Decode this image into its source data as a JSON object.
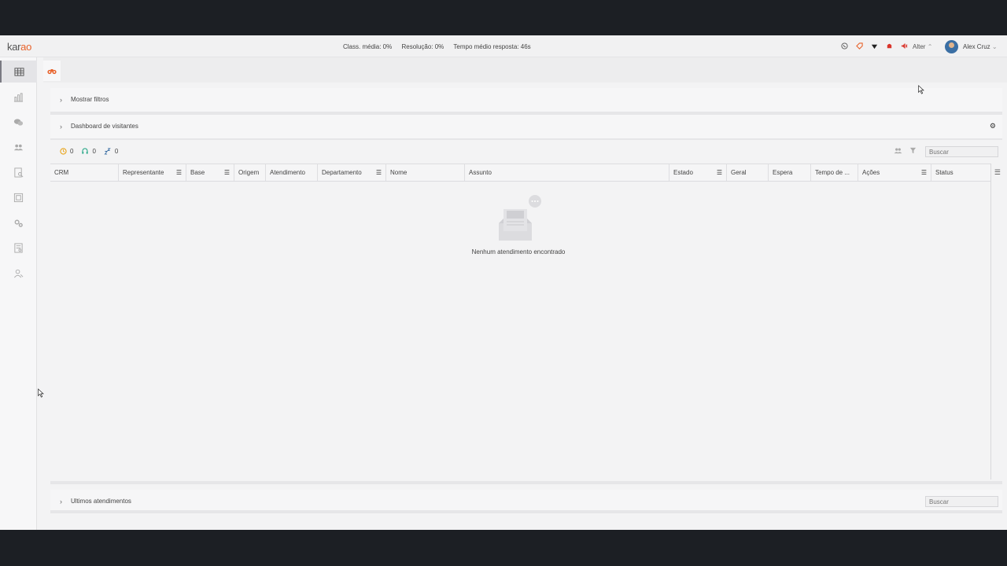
{
  "app": {
    "logo_text_a": "kar",
    "logo_text_b": "ao"
  },
  "header": {
    "stats": {
      "class_media": "Class. média: 0%",
      "resolucao": "Resolução: 0%",
      "tempo_medio": "Tempo médio resposta: 46s"
    },
    "status_label": "Alter",
    "user_name": "Alex Cruz",
    "icons": [
      "whatsapp-icon",
      "tag-icon",
      "wifi-icon",
      "notification-bell-icon",
      "mute-icon"
    ]
  },
  "sidebar": {
    "items": [
      {
        "icon": "grid-icon",
        "active": true
      },
      {
        "icon": "chart-icon"
      },
      {
        "icon": "chat-icon"
      },
      {
        "icon": "users-icon"
      },
      {
        "icon": "report-icon"
      },
      {
        "icon": "panel-icon"
      },
      {
        "icon": "settings-icon"
      },
      {
        "icon": "document-icon"
      },
      {
        "icon": "contacts-icon"
      }
    ]
  },
  "tab": {
    "icon": "binoculars-icon"
  },
  "filters_panel": {
    "title": "Mostrar filtros"
  },
  "dashboard_panel": {
    "title": "Dashboard de visitantes"
  },
  "counters": {
    "waiting": "0",
    "in_progress": "0",
    "sleeping": "0"
  },
  "search": {
    "placeholder": "Buscar"
  },
  "table": {
    "columns": [
      "CRM",
      "Representante",
      "Base",
      "Origem",
      "Atendimento",
      "Departamento",
      "Nome",
      "Assunto",
      "Estado",
      "Geral",
      "Espera",
      "Tempo de ...",
      "Ações",
      "Status"
    ],
    "empty_message": "Nenhum atendimento encontrado"
  },
  "last_panel": {
    "title": "Ultimos atendimentos"
  },
  "colors": {
    "accent": "#e8622a",
    "waiting": "#e8a317",
    "in_progress": "#2aa889",
    "sleeping": "#3b6fa4"
  }
}
